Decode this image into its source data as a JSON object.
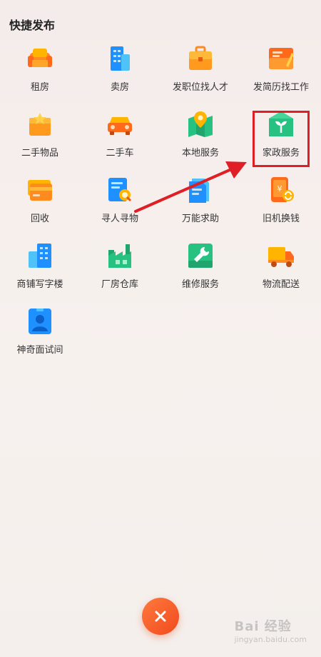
{
  "header": {
    "title": "快捷发布"
  },
  "items": [
    {
      "label": "租房",
      "icon": "sofa-icon"
    },
    {
      "label": "卖房",
      "icon": "building-icon"
    },
    {
      "label": "发职位找人才",
      "icon": "briefcase-icon"
    },
    {
      "label": "发简历找工作",
      "icon": "resume-icon"
    },
    {
      "label": "二手物品",
      "icon": "gift-box-icon"
    },
    {
      "label": "二手车",
      "icon": "car-icon"
    },
    {
      "label": "本地服务",
      "icon": "map-pin-icon"
    },
    {
      "label": "家政服务",
      "icon": "sprout-house-icon"
    },
    {
      "label": "回收",
      "icon": "card-icon"
    },
    {
      "label": "寻人寻物",
      "icon": "search-doc-icon"
    },
    {
      "label": "万能求助",
      "icon": "help-doc-icon"
    },
    {
      "label": "旧机换钱",
      "icon": "phone-exchange-icon"
    },
    {
      "label": "商铺写字楼",
      "icon": "office-icon"
    },
    {
      "label": "厂房仓库",
      "icon": "factory-icon"
    },
    {
      "label": "维修服务",
      "icon": "wrench-icon"
    },
    {
      "label": "物流配送",
      "icon": "truck-icon"
    },
    {
      "label": "神奇面试间",
      "icon": "interview-icon"
    }
  ],
  "close": {
    "icon": "close-icon"
  },
  "watermark": {
    "text": "Bai 经验",
    "sub": "jingyan.baidu.com"
  },
  "colors": {
    "accent": "#f04a1d",
    "highlight": "#e01e26"
  }
}
